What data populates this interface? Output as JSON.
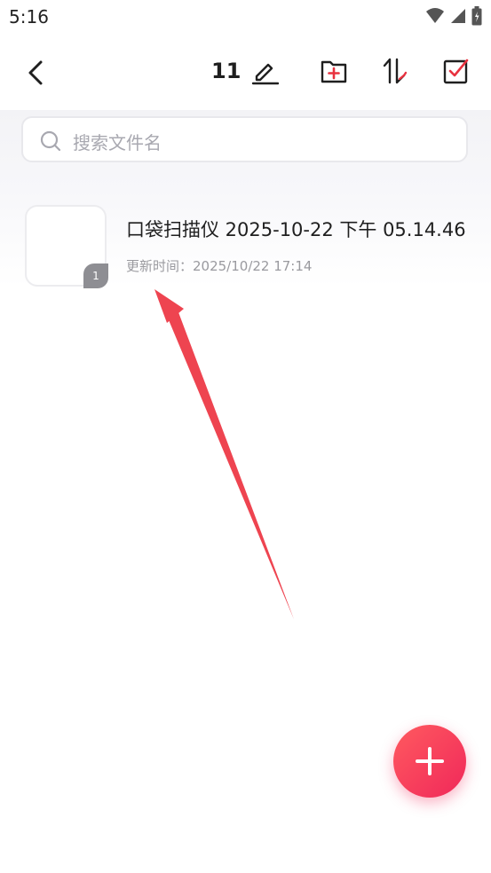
{
  "status_bar": {
    "time": "5:16",
    "icons": [
      "wifi-icon",
      "cellular-icon",
      "battery-icon"
    ]
  },
  "header": {
    "count": "11",
    "icons": [
      "back-icon",
      "edit-icon",
      "new-folder-icon",
      "sort-icon",
      "select-icon"
    ],
    "accent_color": "#e8323f"
  },
  "search": {
    "placeholder": "搜索文件名"
  },
  "documents": [
    {
      "title": "口袋扫描仪 2025-10-22 下午 05.14.46",
      "meta": "更新时间：2025/10/22 17:14",
      "page_count": "1"
    }
  ],
  "fab": {
    "icon": "plus-icon",
    "color": "#f0285a"
  },
  "annotation": {
    "arrow_color": "#ee4450"
  }
}
